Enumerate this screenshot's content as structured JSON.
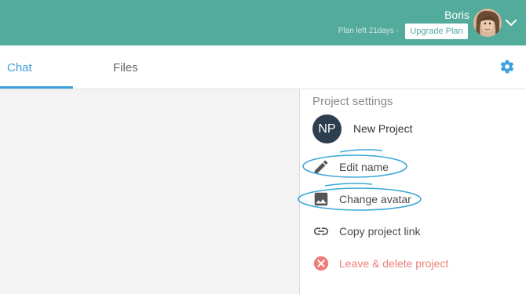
{
  "header": {
    "user_name": "Boris",
    "plan_text": "Plan left 21days -",
    "upgrade_label": "Upgrade Plan",
    "bar_color": "#53ab9c"
  },
  "tabs": [
    {
      "label": "Chat",
      "active": true
    },
    {
      "label": "Files",
      "active": false
    }
  ],
  "settings": {
    "title": "Project settings",
    "project": {
      "initials": "NP",
      "name": "New Project"
    },
    "items": [
      {
        "label": "Edit name",
        "icon": "pencil-icon"
      },
      {
        "label": "Change avatar",
        "icon": "image-icon"
      },
      {
        "label": "Copy project link",
        "icon": "link-icon"
      },
      {
        "label": "Leave & delete project",
        "icon": "close-circle-icon",
        "color": "#ee7e77"
      }
    ]
  },
  "colors": {
    "accent": "#3fa1dc",
    "danger": "#ee7e77",
    "annotation": "#3aa7d9"
  }
}
